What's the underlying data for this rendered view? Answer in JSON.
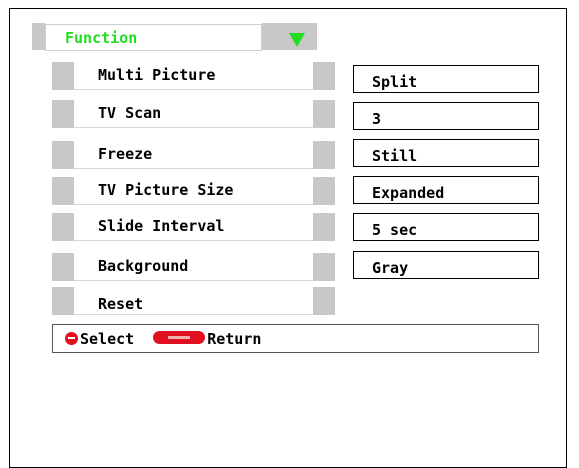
{
  "menu": {
    "title": "Function",
    "items": [
      {
        "label": "Multi Picture",
        "value": "Split"
      },
      {
        "label": "TV Scan",
        "value": "3"
      },
      {
        "label": "Freeze",
        "value": "Still"
      },
      {
        "label": "TV Picture Size",
        "value": "Expanded"
      },
      {
        "label": "Slide Interval",
        "value": "5 sec"
      },
      {
        "label": "Background",
        "value": "Gray"
      },
      {
        "label": "Reset"
      }
    ]
  },
  "footer": {
    "select_label": "Select",
    "return_label": "Return"
  },
  "colors": {
    "title_text": "#22dd22",
    "panel_gray": "#c8c8c8",
    "button_red": "#e0101e"
  },
  "icons": {
    "select": "red-round-button-icon",
    "enter": "enter-button-icon",
    "dropdown": "triangle-down-icon"
  }
}
